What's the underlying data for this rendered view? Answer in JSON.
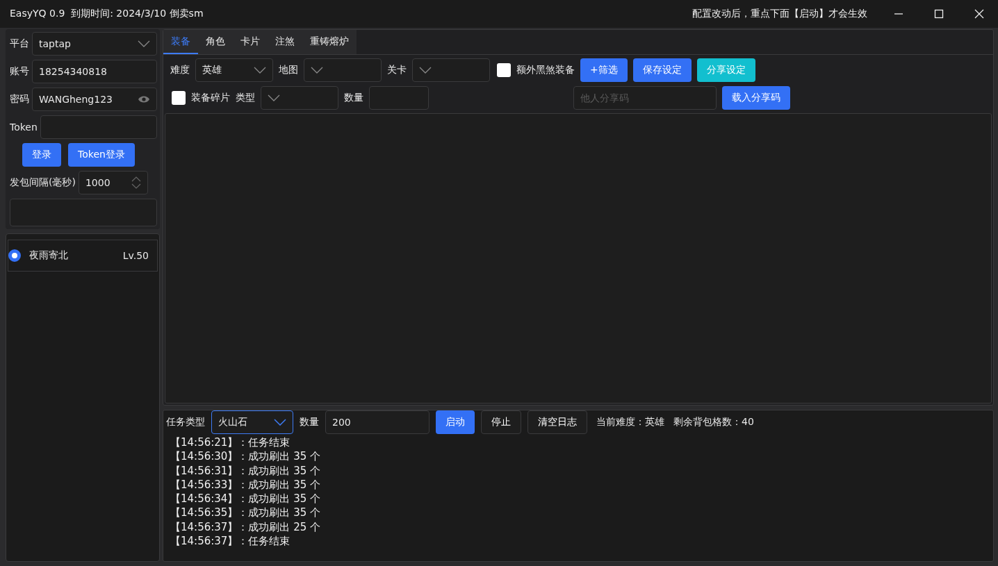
{
  "window": {
    "title": "EasyYQ 0.9  到期时间: 2024/3/10 倒卖sm",
    "notice": "配置改动后，重点下面【启动】才会生效"
  },
  "login": {
    "fields": [
      {
        "label": "平台",
        "kind": "select",
        "value": "taptap"
      },
      {
        "label": "账号",
        "kind": "text",
        "value": "18254340818"
      },
      {
        "label": "密码",
        "kind": "password",
        "value": "WANGheng123"
      },
      {
        "label": "Token",
        "kind": "text"
      }
    ],
    "buttons": [
      "登录",
      "Token登录"
    ],
    "interval": {
      "label": "发包间隔(毫秒)",
      "value": "1000"
    }
  },
  "characters": [
    {
      "name": "夜雨寄北",
      "level_text": "Lv.50",
      "selected": true
    }
  ],
  "tabs": [
    {
      "label": "装备",
      "selected": true
    },
    {
      "label": "角色",
      "selected": false
    },
    {
      "label": "卡片",
      "selected": false
    },
    {
      "label": "注煞",
      "selected": false
    },
    {
      "label": "重铸熔炉",
      "selected": false
    }
  ],
  "filters": {
    "row_1": [
      {
        "kind": "select",
        "label": "难度",
        "value": "英雄"
      },
      {
        "kind": "select",
        "label": "地图"
      },
      {
        "kind": "select",
        "label": "关卡"
      },
      {
        "kind": "checkbox",
        "label": "额外黑煞装备",
        "checked": false
      },
      {
        "kind": "button",
        "label": "+筛选"
      },
      {
        "kind": "button",
        "label": "保存设定"
      },
      {
        "kind": "button",
        "label": "分享设定"
      }
    ],
    "row_2": [
      {
        "kind": "checkbox",
        "label": "装备碎片",
        "checked": false
      },
      {
        "kind": "select",
        "label": "类型"
      },
      {
        "kind": "input",
        "label": "数量"
      }
    ],
    "share_code": {
      "placeholder": "他人分享码"
    },
    "load_button": "载入分享码"
  },
  "task_bar": {
    "task_type": {
      "label": "任务类型",
      "value": "火山石"
    },
    "amount": {
      "label": "数量",
      "value": "200"
    },
    "buttons": [
      {
        "label": "启动"
      },
      {
        "label": "停止"
      },
      {
        "label": "清空日志"
      }
    ],
    "status": [
      "当前难度：英雄",
      "剩余背包格数：40"
    ]
  },
  "log": [
    "【14:56:21】：任务结束",
    "【14:56:30】：成功刷出 35 个",
    "【14:56:31】：成功刷出 35 个",
    "【14:56:33】：成功刷出 35 个",
    "【14:56:34】：成功刷出 35 个",
    "【14:56:35】：成功刷出 35 个",
    "【14:56:37】：成功刷出 25 个",
    "【14:56:37】：任务结束"
  ]
}
